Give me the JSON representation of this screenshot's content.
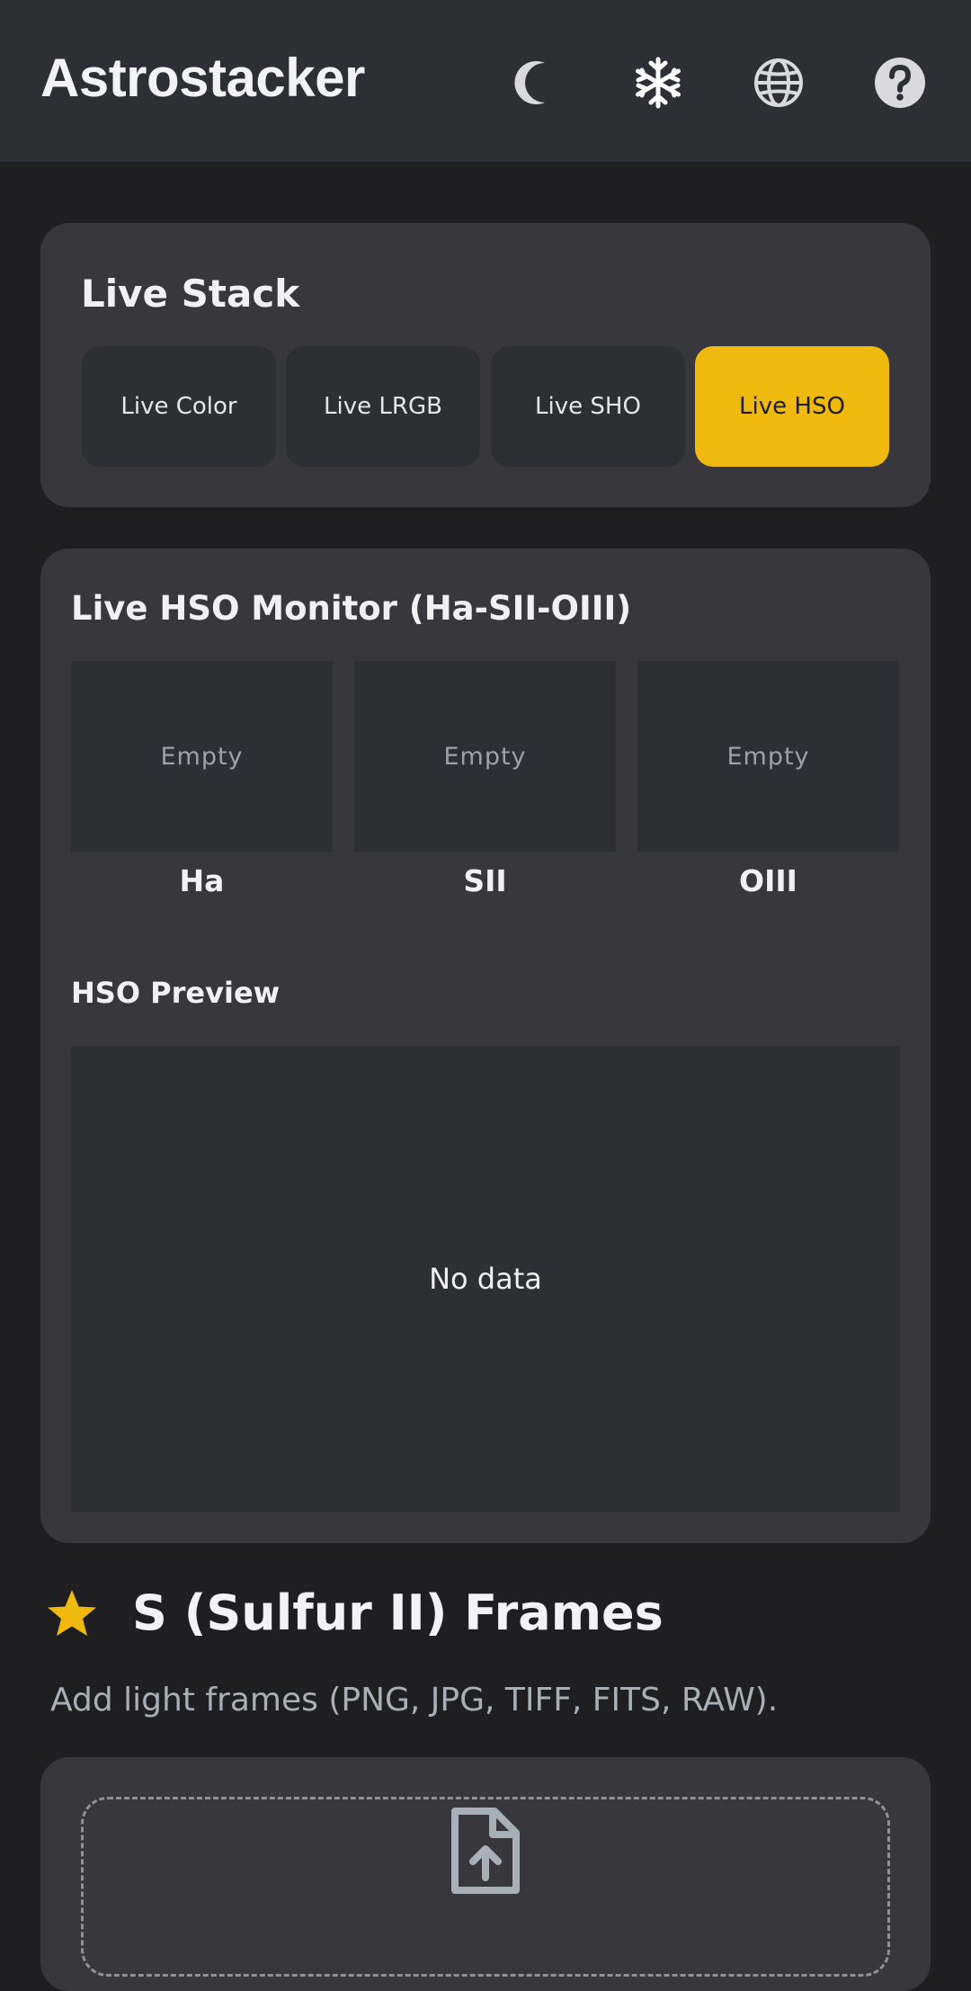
{
  "app": {
    "title": "Astrostacker"
  },
  "toolbar": {
    "icons": [
      "moon-icon",
      "snowflake-icon",
      "globe-icon",
      "help-icon"
    ]
  },
  "live_stack": {
    "title": "Live Stack",
    "modes": [
      {
        "label": "Live Color",
        "active": false
      },
      {
        "label": "Live LRGB",
        "active": false
      },
      {
        "label": "Live SHO",
        "active": false
      },
      {
        "label": "Live HSO",
        "active": true
      }
    ]
  },
  "monitor": {
    "title": "Live HSO Monitor (Ha-SII-OIII)",
    "channels": [
      {
        "label": "Ha",
        "status": "Empty"
      },
      {
        "label": "SII",
        "status": "Empty"
      },
      {
        "label": "OIII",
        "status": "Empty"
      }
    ],
    "preview_title": "HSO Preview",
    "preview_status": "No data"
  },
  "frames": {
    "title": "S (Sulfur II) Frames",
    "subtitle": "Add light frames (PNG, JPG, TIFF, FITS, RAW).",
    "upload_icon": "file-upload-icon"
  },
  "colors": {
    "accent": "#f0b90d",
    "background": "#1f1f21",
    "card": "#38373e",
    "panel": "#2d2f36"
  }
}
